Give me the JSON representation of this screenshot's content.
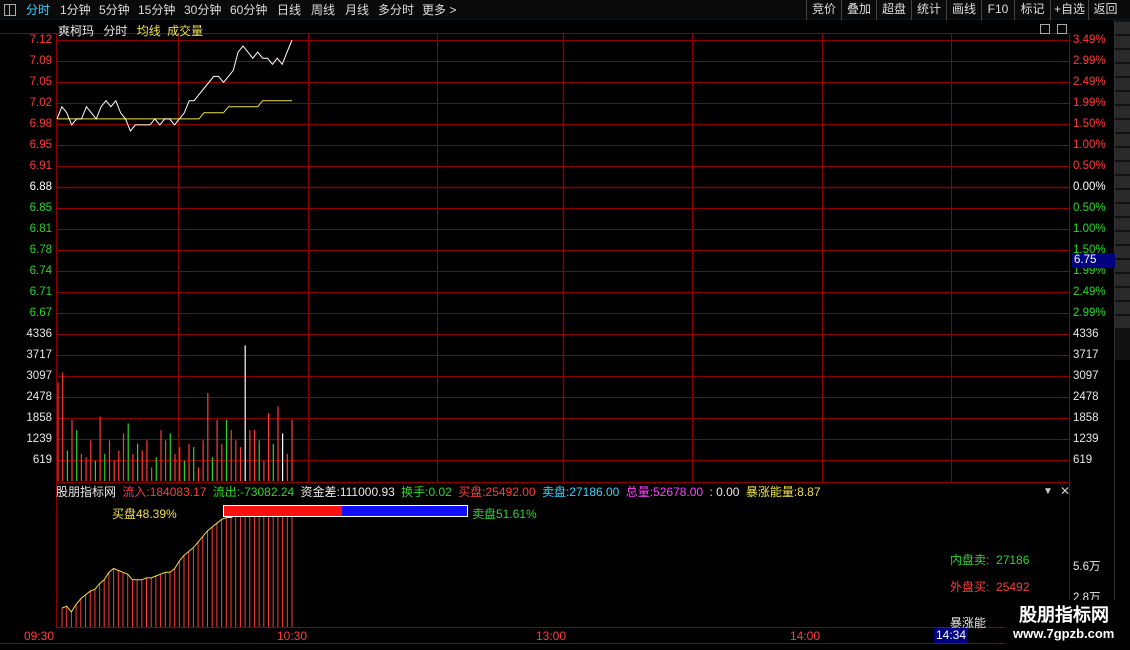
{
  "toolbar": {
    "tabs": [
      "分时",
      "1分钟",
      "5分钟",
      "15分钟",
      "30分钟",
      "60分钟",
      "日线",
      "周线",
      "月线",
      "多分时",
      "更多 >"
    ],
    "right_buttons": [
      "竞价",
      "叠加",
      "超盘",
      "统计",
      "画线",
      "F10",
      "标记",
      "+自选",
      "返回"
    ]
  },
  "legend": {
    "name": "爽柯玛",
    "mode": "分时",
    "avg": "均线",
    "vol": "成交量"
  },
  "price_axis_left": [
    "7.12",
    "7.09",
    "7.05",
    "7.02",
    "6.98",
    "6.95",
    "6.91",
    "6.88",
    "6.85",
    "6.81",
    "6.78",
    "6.74",
    "6.71",
    "6.67"
  ],
  "pct_axis_right": [
    "3.49%",
    "2.99%",
    "2.49%",
    "1.99%",
    "1.50%",
    "1.00%",
    "0.50%",
    "0.00%",
    "0.50%",
    "1.00%",
    "1.50%",
    "1.99%",
    "2.49%",
    "2.99%"
  ],
  "cursor_price": "6.75",
  "volume_axis": [
    "4336",
    "3717",
    "3097",
    "2478",
    "1858",
    "1239",
    "619"
  ],
  "indicator": {
    "name": "股朋指标网",
    "inflow_label": "流入:",
    "inflow": "184083.17",
    "outflow_label": "流出:",
    "outflow": "-73082.24",
    "diff_label": "资金差:",
    "diff": "111000.93",
    "turnover_label": "换手:",
    "turnover": "0.02",
    "buy_label": "买盘:",
    "buy": "25492.00",
    "sell_label": "卖盘:",
    "sell": "27186.00",
    "total_label": "总量:",
    "total": "52678.00",
    "sep": ": 0.00",
    "energy_label": "暴涨能量:",
    "energy": "8.87"
  },
  "buy_pct_label": "买盘48.39%",
  "sell_pct_label": "卖盘51.61%",
  "buy_fraction": 0.4839,
  "inner_sell_label": "内盘卖:",
  "inner_sell": "27186",
  "outer_buy_label": "外盘买:",
  "outer_buy": "25492",
  "energy_short": "暴涨能",
  "sub_axis": [
    "5.6万",
    "2.8万"
  ],
  "time_axis": [
    "09:30",
    "10:30",
    "13:00",
    "14:00"
  ],
  "time_cursor": "14:34",
  "watermark": {
    "line1": "股朋指标网",
    "line2": "www.7gpzb.com"
  },
  "colors": {
    "grid": "#8b0000",
    "up": "#ff3b3b",
    "down": "#2bd62b",
    "price": "#ffffff",
    "avg": "#f0e050",
    "buy": "#ff1010",
    "sell": "#1010ff"
  },
  "chart_data": {
    "type": "line",
    "series": [
      {
        "name": "分时",
        "values": [
          6.99,
          7.01,
          7.0,
          6.98,
          6.99,
          6.99,
          7.01,
          7.0,
          6.99,
          7.01,
          7.02,
          7.01,
          7.02,
          7.0,
          6.99,
          6.97,
          6.98,
          6.98,
          6.98,
          6.98,
          6.99,
          6.98,
          6.99,
          6.99,
          6.98,
          6.99,
          7.0,
          7.02,
          7.02,
          7.03,
          7.04,
          7.05,
          7.06,
          7.06,
          7.05,
          7.06,
          7.07,
          7.1,
          7.11,
          7.1,
          7.09,
          7.1,
          7.09,
          7.09,
          7.08,
          7.09,
          7.08,
          7.1,
          7.12
        ]
      },
      {
        "name": "均线",
        "values": [
          6.99,
          6.99,
          6.99,
          6.99,
          6.99,
          6.99,
          6.99,
          6.99,
          6.99,
          6.99,
          6.99,
          6.99,
          6.99,
          6.99,
          6.99,
          6.99,
          6.99,
          6.99,
          6.99,
          6.99,
          6.99,
          6.99,
          6.99,
          6.99,
          6.99,
          6.99,
          6.99,
          6.99,
          6.99,
          6.99,
          7.0,
          7.0,
          7.0,
          7.0,
          7.0,
          7.01,
          7.01,
          7.01,
          7.01,
          7.01,
          7.01,
          7.01,
          7.02,
          7.02,
          7.02,
          7.02,
          7.02,
          7.02,
          7.02
        ]
      }
    ],
    "volume": [
      2900,
      3200,
      900,
      1800,
      1500,
      800,
      700,
      1200,
      600,
      1900,
      800,
      1200,
      600,
      900,
      1400,
      1700,
      800,
      1100,
      900,
      1200,
      400,
      700,
      1500,
      1200,
      1400,
      800,
      1000,
      600,
      1100,
      1000,
      400,
      1200,
      2600,
      700,
      1800,
      1100,
      1800,
      1500,
      1200,
      1000,
      4000,
      1500,
      1500,
      1200,
      600,
      2000,
      1100,
      2200,
      1400,
      800,
      1800
    ],
    "volume_up": [
      1,
      1,
      0,
      1,
      0,
      1,
      1,
      1,
      0,
      1,
      0,
      1,
      1,
      1,
      1,
      0,
      1,
      0,
      1,
      1,
      1,
      0,
      1,
      1,
      0,
      1,
      1,
      0,
      1,
      0,
      1,
      1,
      1,
      0,
      1,
      1,
      0,
      1,
      1,
      1,
      2,
      1,
      1,
      0,
      1,
      1,
      0,
      1,
      2,
      1,
      1
    ],
    "accum": [
      1.0,
      1.1,
      0.8,
      1.2,
      1.5,
      1.7,
      1.9,
      2.0,
      2.3,
      2.5,
      2.9,
      3.1,
      3.0,
      2.9,
      2.8,
      2.5,
      2.5,
      2.5,
      2.6,
      2.6,
      2.7,
      2.8,
      2.9,
      2.9,
      3.1,
      3.5,
      3.8,
      4.0,
      4.2,
      4.5,
      4.8,
      5.1,
      5.3,
      5.5,
      5.7,
      5.8,
      5.8,
      5.9,
      5.9,
      5.9,
      5.9,
      5.9,
      5.9,
      6.0,
      6.0,
      6.0,
      6.0,
      6.0,
      6.0,
      6.0
    ],
    "xlabel": "",
    "ylabel": "",
    "ylim": [
      6.67,
      7.12
    ],
    "x": [
      "09:30",
      "10:30",
      "13:00",
      "14:00"
    ]
  }
}
